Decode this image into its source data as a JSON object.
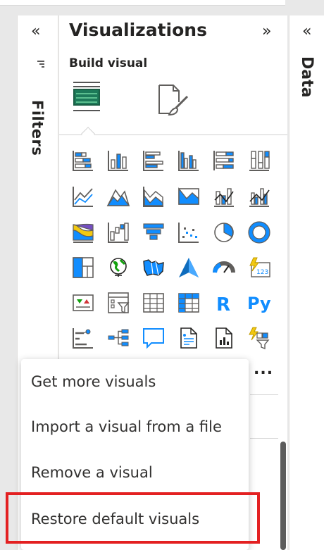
{
  "filters": {
    "label": "Filters"
  },
  "visualizations": {
    "title": "Visualizations",
    "subtitle": "Build visual",
    "more_label": "..."
  },
  "data_pane": {
    "label": "Data"
  },
  "context_menu": {
    "items": [
      {
        "label": "Get more visuals"
      },
      {
        "label": "Import a visual from a file"
      },
      {
        "label": "Remove a visual"
      },
      {
        "label": "Restore default visuals"
      }
    ]
  },
  "icons": {
    "r_label": "R",
    "py_label": "Py",
    "kpi_label": "123"
  },
  "colors": {
    "accent_blue": "#118dff",
    "gray": "#605e5c",
    "highlight_red": "#e32021",
    "format_green": "#1d7a59"
  }
}
